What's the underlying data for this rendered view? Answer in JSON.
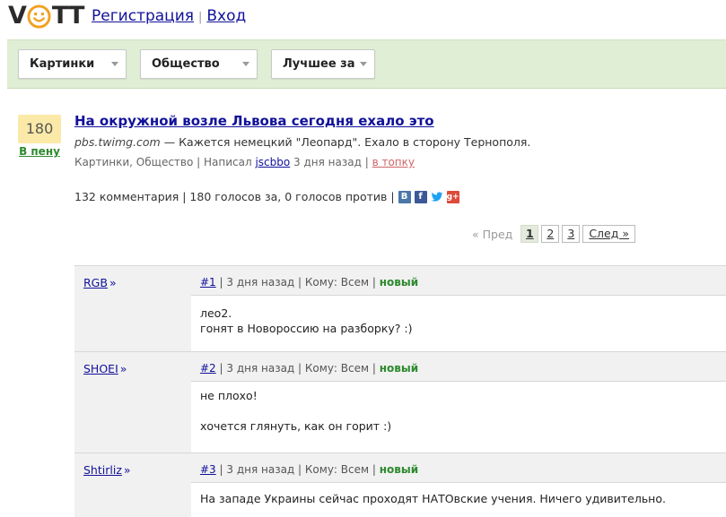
{
  "logo": {
    "text_v": "V",
    "text_tt": "TT"
  },
  "auth": {
    "register": "Регистрация",
    "separator": "|",
    "login": "Вход"
  },
  "filters": [
    {
      "label": "Картинки"
    },
    {
      "label": "Общество"
    },
    {
      "label": "Лучшее за"
    }
  ],
  "post": {
    "score": "180",
    "trash_link": "В пену",
    "title": "На окружной возле Львова сегодня ехало это",
    "domain": "pbs.twimg.com",
    "description": " — Кажется немецкий \"Леопард\". Ехало в сторону Тернополя.",
    "meta_categories": "Картинки, Общество | Написал ",
    "author": "jscbbo",
    "meta_time": " 3 дня назад | ",
    "to_top": "в топку",
    "stats": "132 комментария | 180 голосов за, 0 голосов против |",
    "share": {
      "vk": "В",
      "fb": "f",
      "tw": "🐦",
      "gp": "g+"
    }
  },
  "pager": {
    "prev": "« Пред",
    "pages": [
      "1",
      "2",
      "3"
    ],
    "next": "След »"
  },
  "comments": [
    {
      "author": "RGB",
      "num": "#1",
      "meta": " | 3 дня назад | Кому: Всем | ",
      "badge": "новый",
      "lines": [
        "лео2.",
        "гонят в Новороссию на разборку? :)"
      ]
    },
    {
      "author": "SHOEI",
      "num": "#2",
      "meta": " | 3 дня назад | Кому: Всем | ",
      "badge": "новый",
      "lines": [
        "не плохо!",
        "",
        "хочется глянуть, как он горит :)"
      ]
    },
    {
      "author": "Shtirliz",
      "num": "#3",
      "meta": " | 3 дня назад | Кому: Всем | ",
      "badge": "новый",
      "lines": [
        "На западе Украины сейчас проходят НАТОвские учения. Ничего удивительно."
      ]
    }
  ],
  "colors": {
    "link": "#11119a",
    "green": "#2e8a2e",
    "filter_bg": "#dfeed4",
    "score_bg": "#fbe9a8",
    "to_top": "#cc6666"
  }
}
